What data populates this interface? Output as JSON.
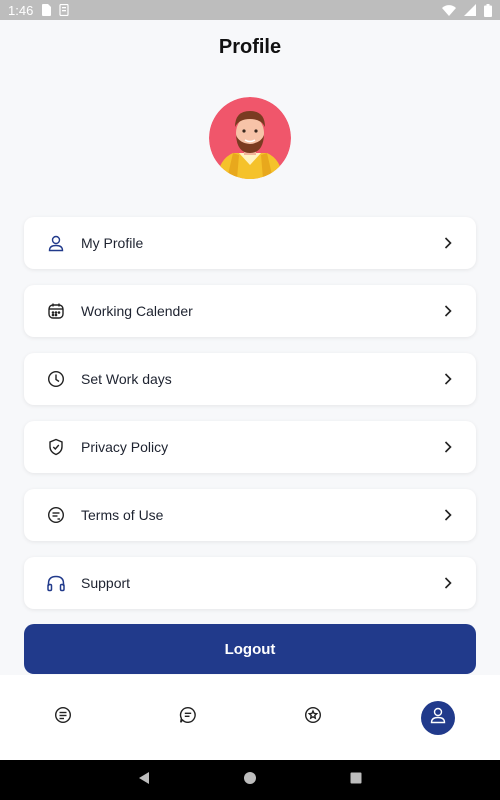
{
  "status_bar": {
    "time": "1:46"
  },
  "page": {
    "title": "Profile"
  },
  "menu": {
    "items": [
      {
        "label": "My Profile",
        "icon": "user-icon"
      },
      {
        "label": "Working Calender",
        "icon": "calendar-icon"
      },
      {
        "label": "Set Work days",
        "icon": "clock-icon"
      },
      {
        "label": "Privacy Policy",
        "icon": "shield-check-icon"
      },
      {
        "label": "Terms of Use",
        "icon": "document-chat-icon"
      },
      {
        "label": "Support",
        "icon": "headphones-icon"
      }
    ]
  },
  "logout": {
    "label": "Logout"
  },
  "bottom_nav": {
    "items": [
      {
        "icon": "list-icon",
        "active": false
      },
      {
        "icon": "chat-icon",
        "active": false
      },
      {
        "icon": "badge-icon",
        "active": false
      },
      {
        "icon": "profile-icon",
        "active": true
      }
    ]
  },
  "colors": {
    "primary": "#213a8b",
    "background": "#f7f8fa",
    "card": "#ffffff",
    "status_bar": "#bdbdbd"
  }
}
